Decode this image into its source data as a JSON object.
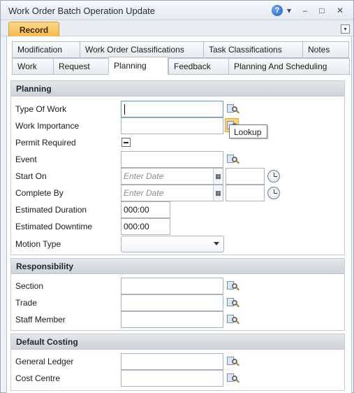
{
  "window": {
    "title": "Work Order Batch Operation Update"
  },
  "title_buttons": {
    "dropdown": "▾",
    "minimize": "–",
    "maximize": "□",
    "close": "✕",
    "help": "?"
  },
  "ribbon": {
    "record_tab": "Record",
    "collapse": "▾"
  },
  "tabs_row1": [
    "Modification",
    "Work Order Classifications",
    "Task Classifications",
    "Notes"
  ],
  "tabs_row2": [
    "Work",
    "Request",
    "Planning",
    "Feedback",
    "Planning And Scheduling"
  ],
  "active_tab": "Planning",
  "planning": {
    "header": "Planning",
    "type_of_work": {
      "label": "Type Of Work",
      "value": ""
    },
    "work_importance": {
      "label": "Work Importance",
      "value": ""
    },
    "permit_required": {
      "label": "Permit Required",
      "state": "indeterminate"
    },
    "event": {
      "label": "Event",
      "value": ""
    },
    "start_on": {
      "label": "Start On",
      "placeholder": "Enter Date",
      "time": ""
    },
    "complete_by": {
      "label": "Complete By",
      "placeholder": "Enter Date",
      "time": ""
    },
    "estimated_duration": {
      "label": "Estimated Duration",
      "value": "000:00"
    },
    "estimated_downtime": {
      "label": "Estimated Downtime",
      "value": "000:00"
    },
    "motion_type": {
      "label": "Motion Type",
      "value": ""
    }
  },
  "responsibility": {
    "header": "Responsibility",
    "section": {
      "label": "Section",
      "value": ""
    },
    "trade": {
      "label": "Trade",
      "value": ""
    },
    "staff_member": {
      "label": "Staff Member",
      "value": ""
    }
  },
  "default_costing": {
    "header": "Default Costing",
    "general_ledger": {
      "label": "General Ledger",
      "value": ""
    },
    "cost_centre": {
      "label": "Cost Centre",
      "value": ""
    }
  },
  "tooltip": {
    "text": "Lookup"
  },
  "colors": {
    "record_tab": "#f4b84a",
    "focus_border": "#6a94c9",
    "group_header": "#d3d8de"
  }
}
